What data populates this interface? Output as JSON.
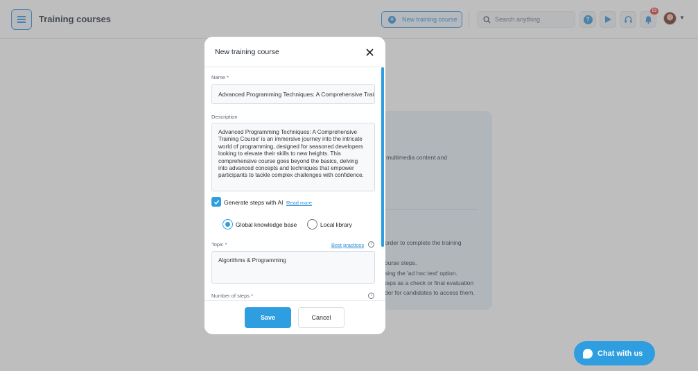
{
  "app": {
    "title": "Training courses",
    "new_course_label": "New training course",
    "search_placeholder": "Search anything",
    "notification_count": "53"
  },
  "background": {
    "text_lines": [
      "h multimedia content and",
      "order to complete the training",
      "ourse steps.",
      "sing the 'ad hoc test' option.",
      "teps as a check or final evaluation",
      "der for candidates to access them."
    ]
  },
  "modal": {
    "title": "New training course",
    "name_label": "Name *",
    "name_value": "Advanced Programming Techniques: A Comprehensive Training Course",
    "description_label": "Description",
    "description_value": "Advanced Programming Techniques: A Comprehensive Training Course' is an immersive journey into the intricate world of programming, designed for seasoned developers looking to elevate their skills to new heights. This comprehensive course goes beyond the basics, delving into advanced concepts and techniques that empower participants to tackle complex challenges with confidence.",
    "generate_ai_label": "Generate steps with AI",
    "read_more_label": "Read more",
    "radio_global_label": "Global knowledge base",
    "radio_local_label": "Local library",
    "topic_label": "Topic *",
    "best_practices_label": "Best practices",
    "topic_value": "Algorithms & Programming",
    "steps_label": "Number of steps *",
    "save_label": "Save",
    "cancel_label": "Cancel"
  },
  "chat": {
    "label": "Chat with us"
  },
  "colors": {
    "accent": "#2f9ee0",
    "brand_blue": "#2f8fd8",
    "badge_red": "#e53935"
  }
}
